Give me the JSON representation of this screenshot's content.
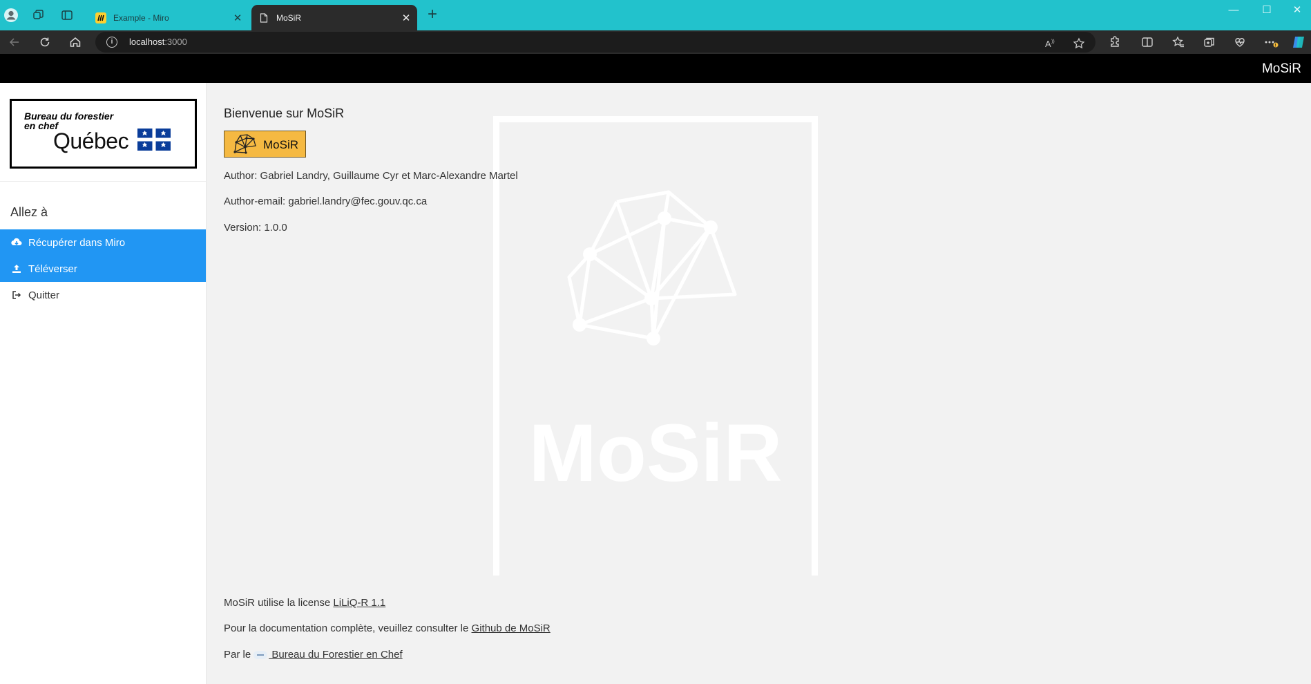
{
  "browser": {
    "tabs": [
      {
        "title": "Example - Miro",
        "active": false
      },
      {
        "title": "MoSiR",
        "active": true
      }
    ],
    "url_host": "localhost",
    "url_port": ":3000"
  },
  "app": {
    "brand": "MoSiR",
    "logo": {
      "line1": "Bureau du forestier",
      "line2": "en chef",
      "line3": "Québec"
    },
    "sidebar": {
      "heading": "Allez à",
      "items": [
        {
          "label": "Récupérer dans Miro",
          "icon": "cloud-download-icon",
          "highlighted": true
        },
        {
          "label": "Téléverser",
          "icon": "upload-icon",
          "highlighted": true
        },
        {
          "label": "Quitter",
          "icon": "sign-out-icon",
          "highlighted": false
        }
      ]
    },
    "main": {
      "title": "Bienvenue sur MoSiR",
      "badge_text": "MoSiR",
      "watermark_text": "MoSiR",
      "author": "Author: Gabriel Landry, Guillaume Cyr et Marc-Alexandre Martel",
      "author_email": "Author-email: gabriel.landry@fec.gouv.qc.ca",
      "version": "Version: 1.0.0",
      "footer": {
        "license_prefix": "MoSiR utilise la license ",
        "license_link": "LiLiQ-R 1.1",
        "docs_prefix": "Pour la documentation complète, veuillez consulter le ",
        "docs_link": "Github de MoSiR",
        "by_prefix": "Par le",
        "by_link": " Bureau du Forestier en Chef"
      }
    }
  },
  "colors": {
    "titlebar": "#22c2cc",
    "toolbar": "#2b2b2b",
    "appbar": "#000000",
    "accent": "#2196f3",
    "badge": "#f5b942",
    "content_bg": "#f2f2f2"
  }
}
